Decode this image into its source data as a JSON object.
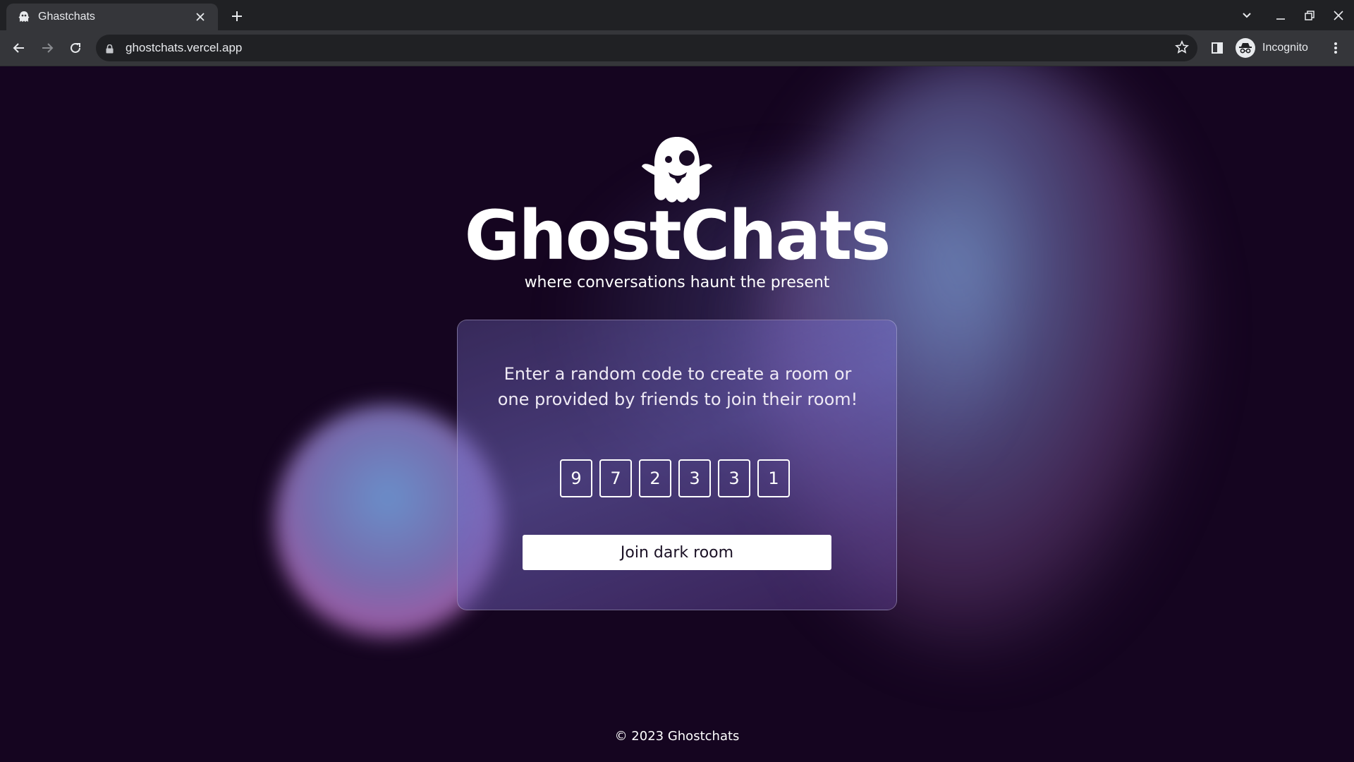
{
  "browser": {
    "tab_title": "Ghastchats",
    "url": "ghostchats.vercel.app",
    "profile_label": "Incognito"
  },
  "hero": {
    "brand": "GhostChats",
    "tagline": "where conversations haunt the present"
  },
  "card": {
    "instructions": "Enter a random code to create a room or one provided by friends to join their room!",
    "code_digits": [
      "9",
      "7",
      "2",
      "3",
      "3",
      "1"
    ],
    "join_label": "Join dark room"
  },
  "footer": {
    "text": "© 2023 Ghostchats"
  },
  "colors": {
    "page_bg": "#150520",
    "chrome_dark": "#202124",
    "chrome_mid": "#35363a",
    "button_bg": "#ffffff"
  }
}
